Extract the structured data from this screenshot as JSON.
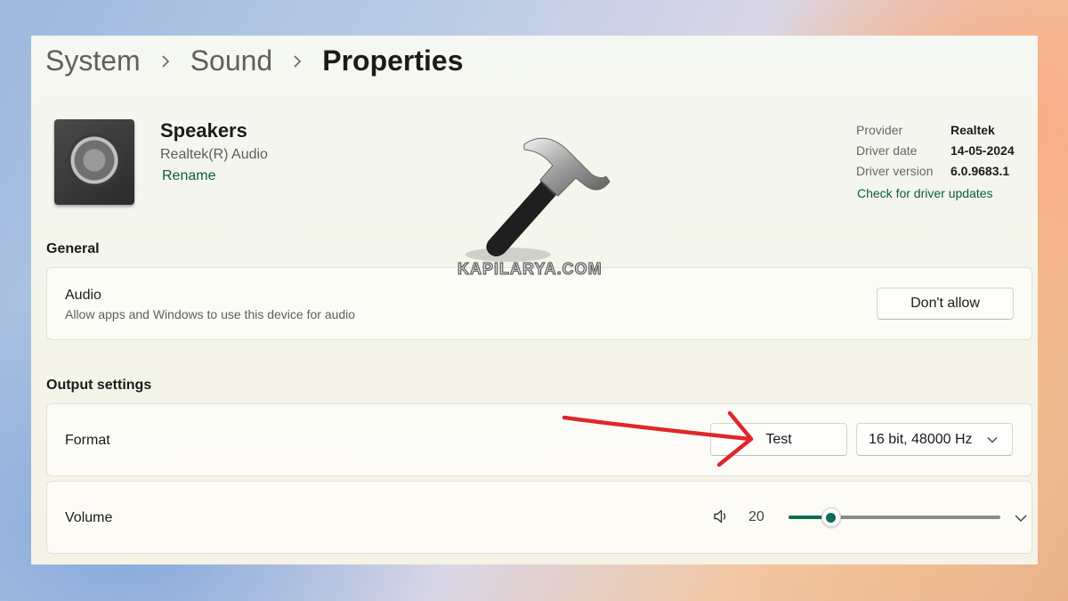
{
  "breadcrumb": {
    "items": [
      "System",
      "Sound"
    ],
    "current": "Properties"
  },
  "device": {
    "name": "Speakers",
    "subtitle": "Realtek(R) Audio",
    "rename": "Rename",
    "icon": "speaker-icon"
  },
  "driver": {
    "provider_label": "Provider",
    "provider_value": "Realtek",
    "date_label": "Driver date",
    "date_value": "14-05-2024",
    "version_label": "Driver version",
    "version_value": "6.0.9683.1",
    "update_link": "Check for driver updates"
  },
  "general": {
    "title": "General",
    "audio_title": "Audio",
    "audio_desc": "Allow apps and Windows to use this device for audio",
    "audio_button": "Don't allow"
  },
  "output": {
    "title": "Output settings",
    "format_label": "Format",
    "test_button": "Test",
    "format_value": "16 bit, 48000 Hz",
    "volume_label": "Volume",
    "volume_value": "20",
    "volume_fraction": 0.2
  },
  "watermark": {
    "text": "KAPILARYA.COM"
  },
  "colors": {
    "accent": "#0b6e54",
    "link": "#0b5a44",
    "annotation_arrow": "#e0262a"
  }
}
